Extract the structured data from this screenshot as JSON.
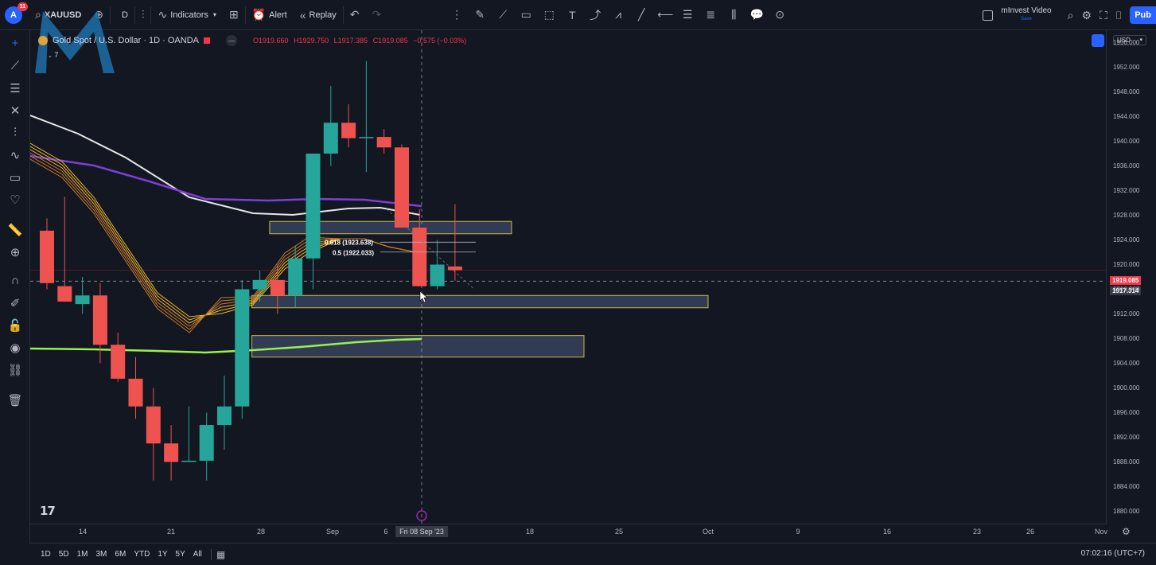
{
  "toolbar": {
    "avatar_letter": "A",
    "notifications": "11",
    "symbol": "XAUUSD",
    "interval": "D",
    "indicators_label": "Indicators",
    "alert_label": "Alert",
    "replay_label": "Replay",
    "layout_name": "mInvest Video",
    "layout_status": "Save",
    "publish_label": "Pub"
  },
  "legend": {
    "title": "Gold Spot / U.S. Dollar · 1D · OANDA",
    "open": "O1919.660",
    "high": "H1929.750",
    "low": "L1917.385",
    "close": "C1919.085",
    "change": "−0.575 (−0.03%)",
    "indicator_count": "7"
  },
  "price_axis": {
    "currency": "USD",
    "ticks": [
      "1956.000",
      "1952.000",
      "1948.000",
      "1944.000",
      "1940.000",
      "1936.000",
      "1932.000",
      "1928.000",
      "1924.000",
      "1920.000",
      "1916.000",
      "1912.000",
      "1908.000",
      "1904.000",
      "1900.000",
      "1896.000",
      "1892.000",
      "1888.000",
      "1884.000",
      "1880.000"
    ],
    "last_price": "1919.085",
    "cursor_price": "1917.314",
    "colors": {
      "last_price": "#f23645",
      "cursor": "#363a45"
    }
  },
  "fib": {
    "level_0618": "0.618 (1923.638)",
    "level_05": "0.5 (1922.033)"
  },
  "time_axis": {
    "ticks": [
      "14",
      "21",
      "28",
      "Sep",
      "6",
      "18",
      "25",
      "Oct",
      "9",
      "16",
      "23",
      "26",
      "Nov"
    ],
    "cursor_label": "Fri 08 Sep '23"
  },
  "bottom": {
    "ranges": [
      "1D",
      "5D",
      "1M",
      "3M",
      "6M",
      "YTD",
      "1Y",
      "5Y",
      "All"
    ],
    "clock": "07:02:16 (UTC+7)"
  },
  "colors": {
    "up": "#26a69a",
    "down": "#ef5350",
    "zone": "#3c4a66",
    "zone_border": "#c8b84a",
    "ma_white": "#e6e6e6",
    "ma_purple": "#7e3ed8",
    "ma_green": "#9cf04a",
    "ribbon": "#e7a23a"
  },
  "chart_data": {
    "type": "candlestick",
    "ylim": [
      1878,
      1958
    ],
    "candles": [
      {
        "o": 1925.5,
        "h": 1927.5,
        "l": 1916,
        "c": 1917
      },
      {
        "o": 1916.5,
        "h": 1931,
        "l": 1914,
        "c": 1914
      },
      {
        "o": 1913.6,
        "h": 1918,
        "l": 1912,
        "c": 1915
      },
      {
        "o": 1915,
        "h": 1917,
        "l": 1904,
        "c": 1907
      },
      {
        "o": 1907,
        "h": 1909,
        "l": 1901,
        "c": 1901.5
      },
      {
        "o": 1901.5,
        "h": 1905,
        "l": 1895,
        "c": 1897
      },
      {
        "o": 1897,
        "h": 1900,
        "l": 1885,
        "c": 1891
      },
      {
        "o": 1891,
        "h": 1894,
        "l": 1885,
        "c": 1888
      },
      {
        "o": 1888,
        "h": 1897,
        "l": 1888,
        "c": 1888.2
      },
      {
        "o": 1888.2,
        "h": 1896,
        "l": 1885,
        "c": 1894
      },
      {
        "o": 1894,
        "h": 1902,
        "l": 1890,
        "c": 1897
      },
      {
        "o": 1897,
        "h": 1917.5,
        "l": 1895,
        "c": 1916
      },
      {
        "o": 1916,
        "h": 1919,
        "l": 1914,
        "c": 1917.5
      },
      {
        "o": 1917.5,
        "h": 1920,
        "l": 1912,
        "c": 1915
      },
      {
        "o": 1915,
        "h": 1923,
        "l": 1913,
        "c": 1921
      },
      {
        "o": 1921,
        "h": 1937,
        "l": 1916,
        "c": 1938
      },
      {
        "o": 1938,
        "h": 1949,
        "l": 1936,
        "c": 1943
      },
      {
        "o": 1943,
        "h": 1946,
        "l": 1939,
        "c": 1940.5
      },
      {
        "o": 1940.5,
        "h": 1953,
        "l": 1935,
        "c": 1940.7
      },
      {
        "o": 1940.7,
        "h": 1942,
        "l": 1938,
        "c": 1939
      },
      {
        "o": 1939,
        "h": 1939.5,
        "l": 1926,
        "c": 1926
      },
      {
        "o": 1926,
        "h": 1929,
        "l": 1916.5,
        "c": 1916.5
      },
      {
        "o": 1916.5,
        "h": 1924,
        "l": 1916,
        "c": 1920
      },
      {
        "o": 1919.7,
        "h": 1929.8,
        "l": 1917.4,
        "c": 1919.1
      }
    ],
    "zones": [
      {
        "start_candle": 13,
        "end_x": "Sep 13",
        "top": 1927,
        "bottom": 1925
      },
      {
        "start_candle": 12,
        "end_x": "Sep 26",
        "top": 1915,
        "bottom": 1913
      },
      {
        "start_candle": 12,
        "end_x": "Sep 20",
        "top": 1908.5,
        "bottom": 1905
      }
    ]
  }
}
